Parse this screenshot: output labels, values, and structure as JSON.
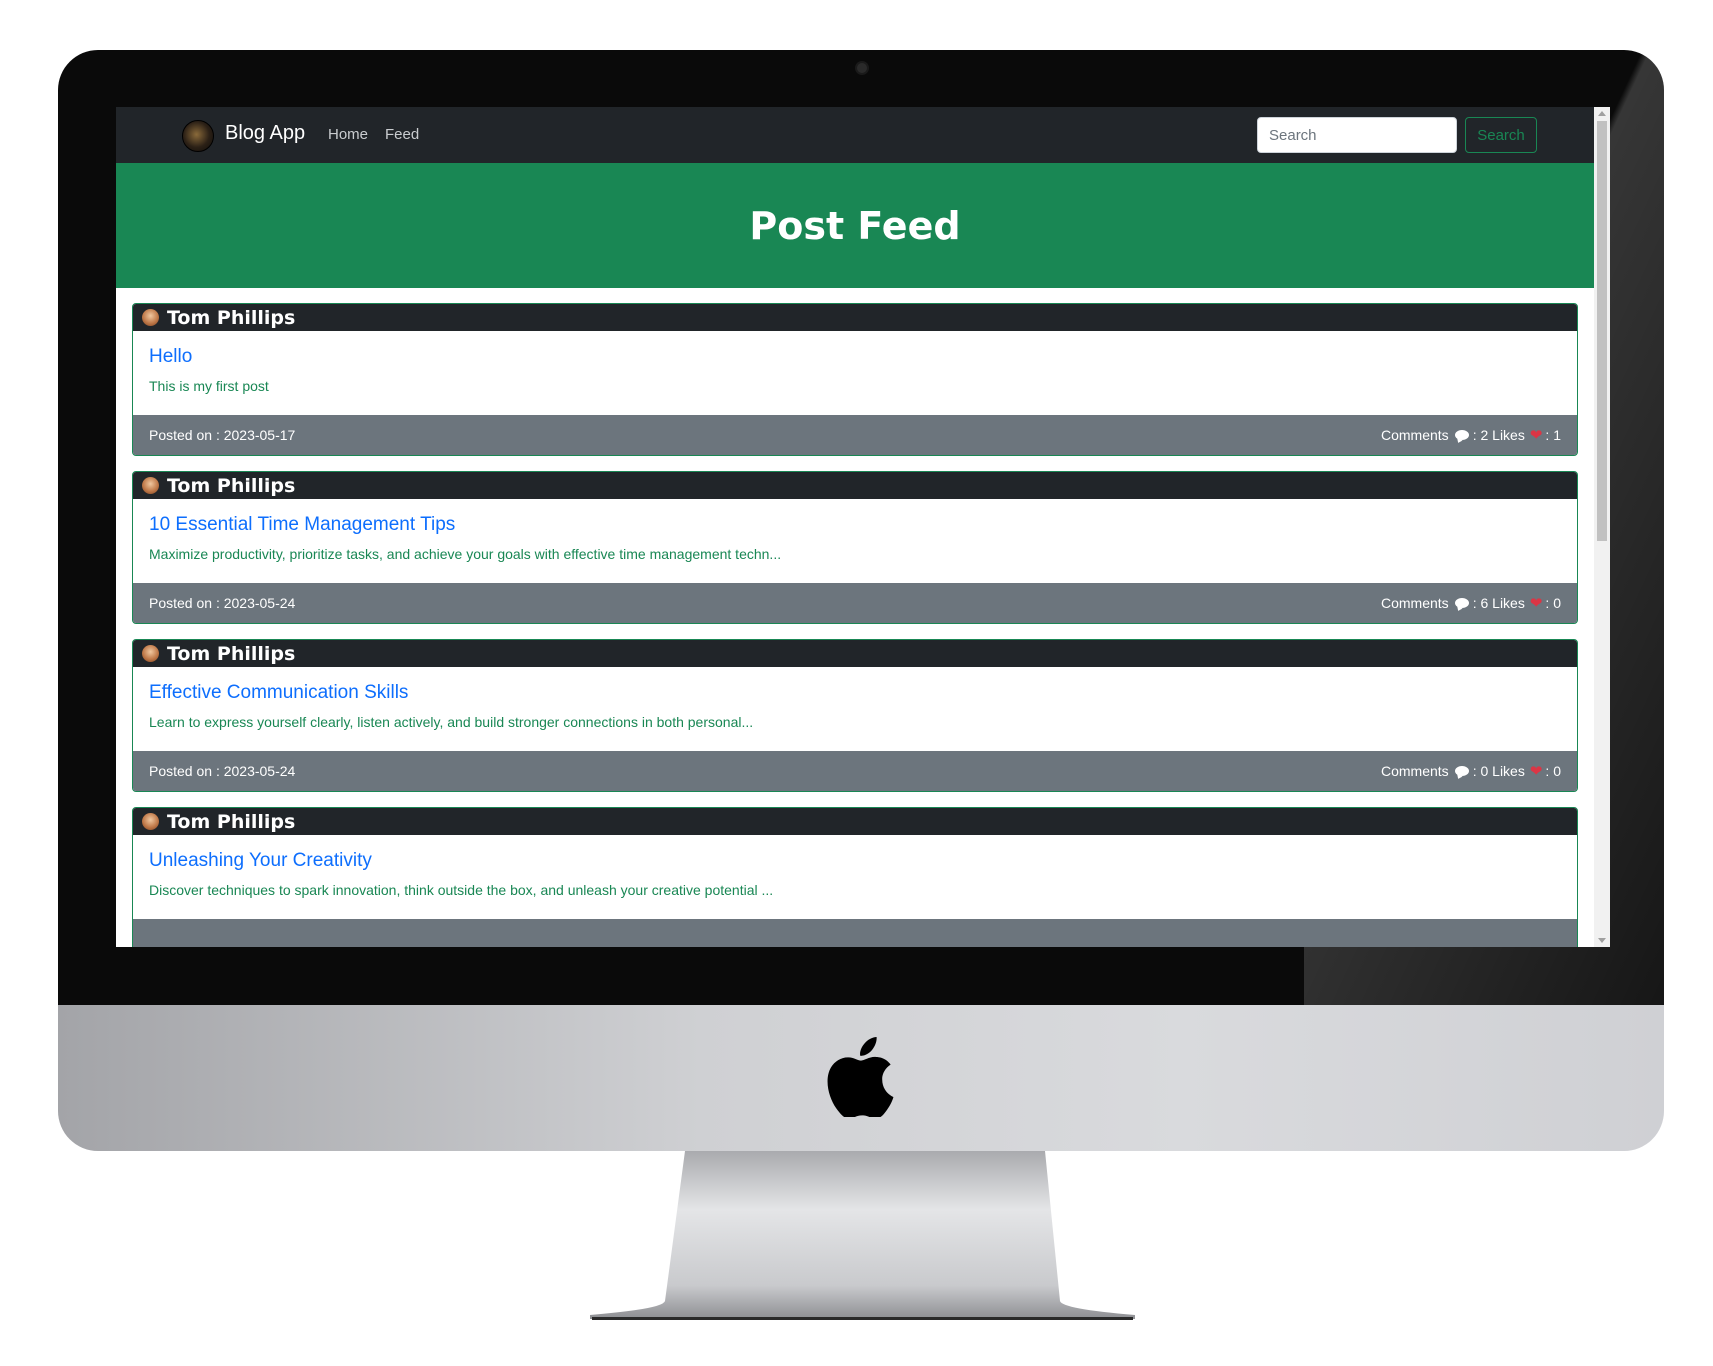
{
  "navbar": {
    "brand": "Blog App",
    "links": [
      "Home",
      "Feed"
    ],
    "search_placeholder": "Search",
    "search_button": "Search"
  },
  "hero": {
    "title": "Post Feed"
  },
  "footer_labels": {
    "posted_on": "Posted on : ",
    "comments": "Comments",
    "likes": "Likes"
  },
  "posts": [
    {
      "author": "Tom Phillips",
      "title": "Hello",
      "excerpt": "This is my first post",
      "date": "2023-05-17",
      "comments": ": 2",
      "likes": ": 1"
    },
    {
      "author": "Tom Phillips",
      "title": "10 Essential Time Management Tips",
      "excerpt": "Maximize productivity, prioritize tasks, and achieve your goals with effective time management techn...",
      "date": "2023-05-24",
      "comments": ": 6",
      "likes": ": 0"
    },
    {
      "author": "Tom Phillips",
      "title": "Effective Communication Skills",
      "excerpt": "Learn to express yourself clearly, listen actively, and build stronger connections in both personal...",
      "date": "2023-05-24",
      "comments": ": 0",
      "likes": ": 0"
    },
    {
      "author": "Tom Phillips",
      "title": "Unleashing Your Creativity",
      "excerpt": "Discover techniques to spark innovation, think outside the box, and unleash your creative potential ...",
      "date": "",
      "comments": "",
      "likes": ""
    }
  ],
  "colors": {
    "primary": "#198754",
    "dark": "#212529",
    "link": "#0d6efd",
    "footer": "#6c757d",
    "heart": "#dc3545"
  }
}
